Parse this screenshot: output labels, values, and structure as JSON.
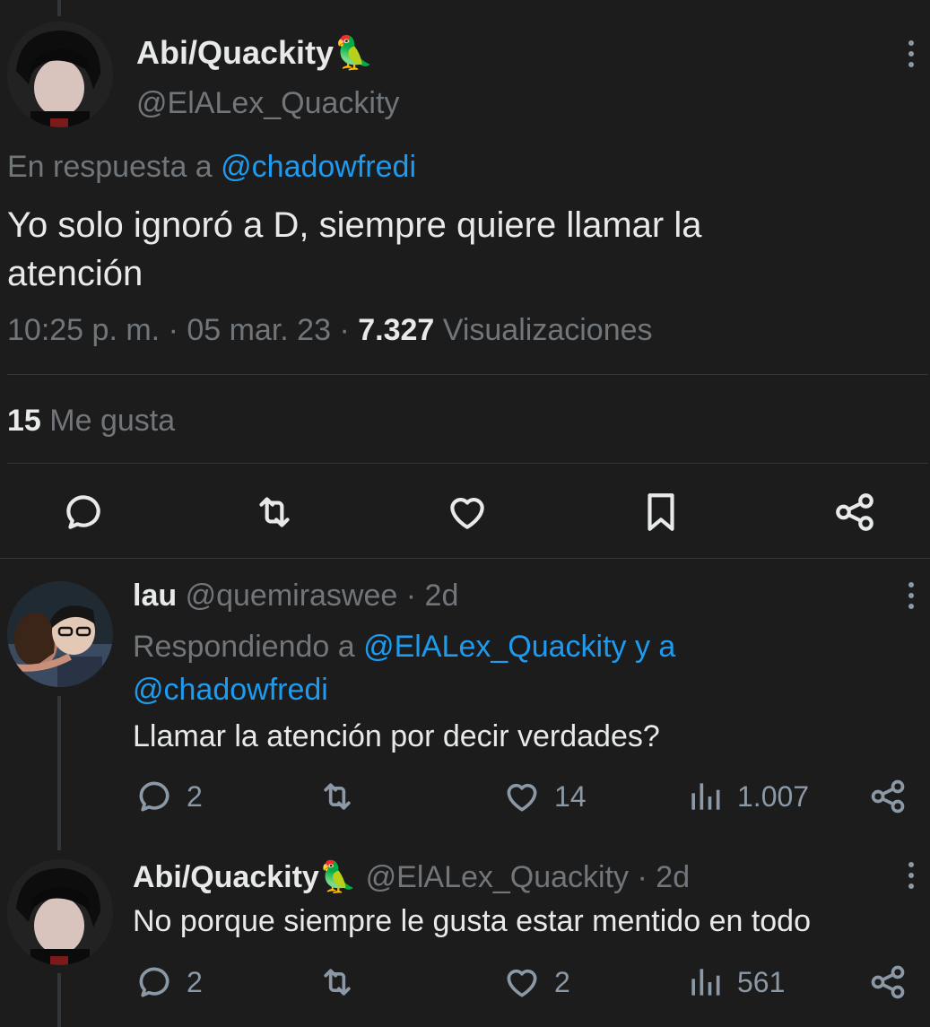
{
  "main_tweet": {
    "display_name": "Abi/Quackity",
    "name_emoji": "🦜",
    "handle": "@ElALex_Quackity",
    "reply_prefix": "En respuesta a",
    "reply_to": "@chadowfredi",
    "text_line1": "Yo solo ignoró a D, siempre quiere llamar la",
    "text_line2": "atención",
    "time": "10:25 p. m.",
    "date": "05 mar. 23",
    "separator": "·",
    "views_count": "7.327",
    "views_label": "Visualizaciones",
    "likes_count": "15",
    "likes_label": "Me gusta"
  },
  "reply1": {
    "display_name": "lau",
    "handle": "@quemiraswee",
    "age": "· 2d",
    "replying_prefix": "Respondiendo a",
    "mention1": "@ElALex_Quackity",
    "and": "y a",
    "mention2": "@chadowfredi",
    "text": "Llamar la atención por decir verdades?",
    "replies": "2",
    "likes": "14",
    "views": "1.007"
  },
  "reply2": {
    "display_name": "Abi/Quackity",
    "name_emoji": "🦜",
    "handle": "@ElALex_Quackity",
    "age": "· 2d",
    "text": "No porque siempre le gusta estar mentido en todo",
    "replies": "2",
    "likes": "2",
    "views": "561"
  },
  "icons": [
    "reply-icon",
    "retweet-icon",
    "like-icon",
    "bookmark-icon",
    "share-icon",
    "views-icon",
    "more-icon"
  ],
  "colors": {
    "background": "#1c1c1c",
    "text": "#e7e9ea",
    "muted": "#71767b",
    "link": "#1d9bf0",
    "icon": "#8b98a5"
  }
}
